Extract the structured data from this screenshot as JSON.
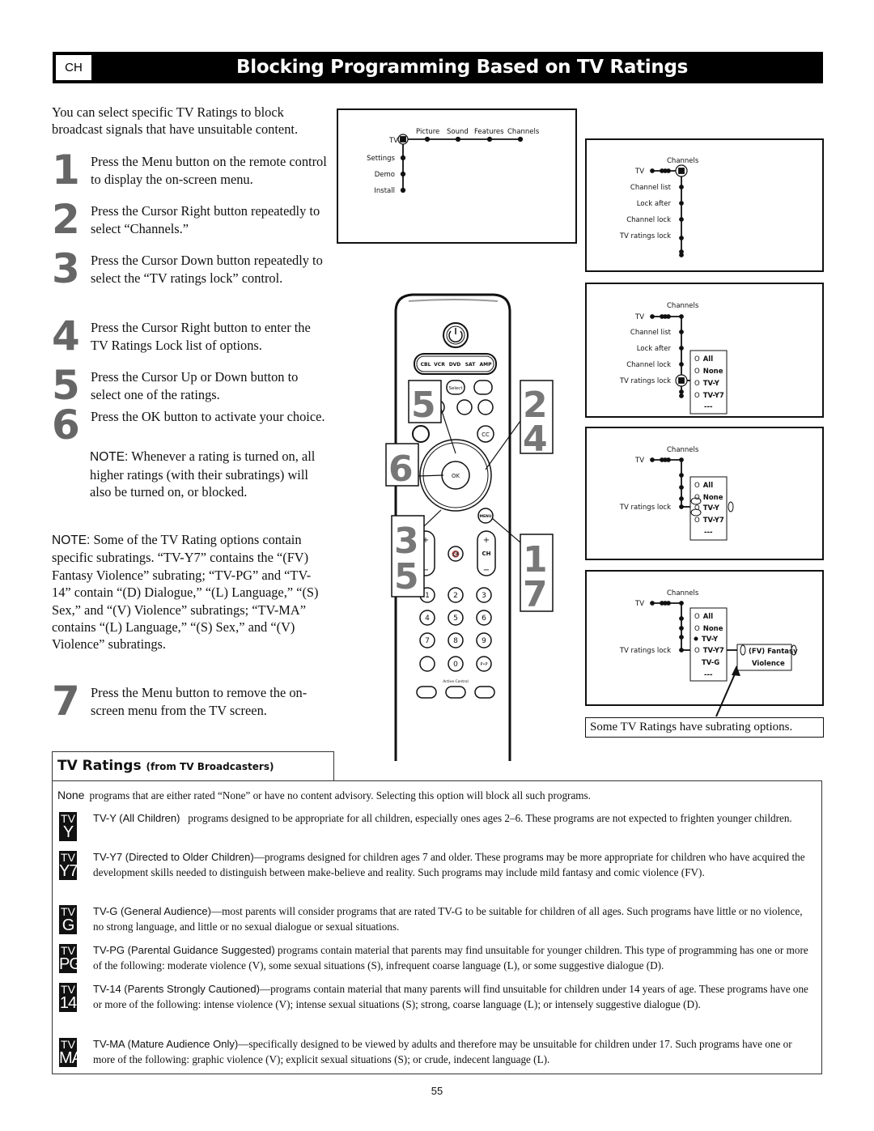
{
  "header": {
    "section_tab": "CH",
    "title": "Blocking Programming Based on TV Ratings"
  },
  "intro": "You can select specific TV Ratings to block broadcast signals that have unsuitable content.",
  "steps": [
    {
      "num": "1",
      "text": "Press the Menu button on the remote control to display the on-screen menu."
    },
    {
      "num": "2",
      "text": "Press the Cursor Right button repeatedly to select “Channels.”"
    },
    {
      "num": "3",
      "text": "Press the Cursor Down button repeatedly to select the “TV ratings lock” control."
    },
    {
      "num": "4",
      "text": "Press the Cursor Right button to enter the TV Ratings Lock list of options."
    },
    {
      "num": "5",
      "text": "Press the Cursor Up or Down button to select one of the ratings."
    },
    {
      "num": "6",
      "text": "Press the OK button to activate your choice."
    },
    {
      "num": "7",
      "text": "Press the Menu button to remove the on-screen menu from the TV screen."
    }
  ],
  "notes": {
    "label": "NOTE:",
    "note1": "Whenever a rating is turned on, all higher ratings (with their subratings) will also be turned on, or blocked.",
    "note2": "Some of the TV Rating options contain specific subratings. “TV-Y7” contains the “(FV) Fantasy Violence” subrating; “TV-PG” and “TV-14” contain “(D) Dialogue,” “(L) Language,” “(S) Sex,” and “(V) Violence” subratings; “TV-MA” contains “(L) Language,” “(S) Sex,” and “(V) Violence” subratings."
  },
  "screen1": {
    "root": "TV",
    "top_items": [
      "Picture",
      "Sound",
      "Features",
      "Channels"
    ],
    "side_items": [
      "Settings",
      "Demo",
      "Install"
    ]
  },
  "screen2": {
    "root": "TV",
    "header": "Channels",
    "items": [
      "Channel list",
      "Lock after",
      "Channel lock",
      "TV ratings lock"
    ]
  },
  "screen3": {
    "root": "TV",
    "header": "Channels",
    "items": [
      "Channel list",
      "Lock after",
      "Channel lock",
      "TV ratings lock"
    ],
    "options": [
      "All",
      "None",
      "TV-Y",
      "TV-Y7",
      "---"
    ],
    "bullet": "O"
  },
  "screen4": {
    "root": "TV",
    "header": "Channels",
    "items": [
      "TV ratings lock"
    ],
    "options": [
      "All",
      "None",
      "TV-Y",
      "TV-Y7",
      "---"
    ],
    "bullet": "O"
  },
  "screen5": {
    "root": "TV",
    "header": "Channels",
    "items": [
      "TV ratings lock"
    ],
    "options": [
      "All",
      "None",
      "TV-Y",
      "TV-Y7",
      "TV-G",
      "---"
    ],
    "bullet": "O",
    "subrating_line1": "(FV)  Fantasy",
    "subrating_line2": "Violence"
  },
  "caption": "Some TV Ratings have subrating options.",
  "remote": {
    "source_buttons": [
      "CBL",
      "VCR",
      "DVD",
      "SAT",
      "AMP"
    ],
    "select_label": "Select",
    "cc_label": "CC",
    "ok_label": "OK",
    "menu_label": "MENU",
    "ch_label": "CH",
    "plus": "+",
    "minus": "−",
    "digits": [
      "1",
      "2",
      "3",
      "4",
      "5",
      "6",
      "7",
      "8",
      "9",
      "0"
    ],
    "pip_label": "P•P",
    "active_control": "Active Control",
    "callouts": [
      "5",
      "6",
      "3",
      "5",
      "2",
      "4",
      "1",
      "7"
    ]
  },
  "ratings": {
    "tab_title": "TV Ratings",
    "tab_subtitle": "(from TV Broadcasters)",
    "items": [
      {
        "badge_top": "",
        "badge_bottom": "",
        "name": "None",
        "text": "programs that are either rated “None” or have no content advisory. Selecting this option will block all such programs."
      },
      {
        "badge_top": "TV",
        "badge_bottom": "Y",
        "name": "TV-Y (All Children)",
        "text": "programs designed to be appropriate for all children, especially ones ages 2–6. These programs are not expected to frighten younger children."
      },
      {
        "badge_top": "TV",
        "badge_bottom": "Y7",
        "name": "TV-Y7 (Directed to Older Children)",
        "text": "—programs designed for children ages 7 and older. These programs may be more appropriate for children who have acquired the development skills needed to distinguish between make-believe and reality. Such programs may include mild fantasy and comic violence (FV)."
      },
      {
        "badge_top": "TV",
        "badge_bottom": "G",
        "name": "TV-G (General Audience)",
        "text": "—most parents will consider programs that are rated TV-G to be suitable for children of all ages. Such programs have little or no violence, no strong language, and little or no sexual dialogue or sexual situations."
      },
      {
        "badge_top": "TV",
        "badge_bottom": "PG",
        "name": "TV-PG (Parental Guidance Suggested)",
        "text": "programs contain material that parents may find unsuitable for younger children. This type of programming has one or more of the following: moderate violence (V), some sexual situations (S), infrequent coarse language (L), or some suggestive dialogue (D)."
      },
      {
        "badge_top": "TV",
        "badge_bottom": "14",
        "name": "TV-14 (Parents Strongly Cautioned)",
        "text": "—programs contain material that many parents will find unsuitable for children under 14 years of age. These programs have one or more of the following: intense violence (V); intense sexual situations (S); strong, coarse language (L); or intensely suggestive dialogue (D)."
      },
      {
        "badge_top": "TV",
        "badge_bottom": "MA",
        "name": "TV-MA  (Mature Audience Only)",
        "text": "—specifically designed to be viewed by adults and therefore may be unsuitable for children under 17. Such programs have one or more of the following: graphic violence (V); explicit sexual situations (S); or crude, indecent language (L)."
      }
    ]
  },
  "page_number": "55"
}
